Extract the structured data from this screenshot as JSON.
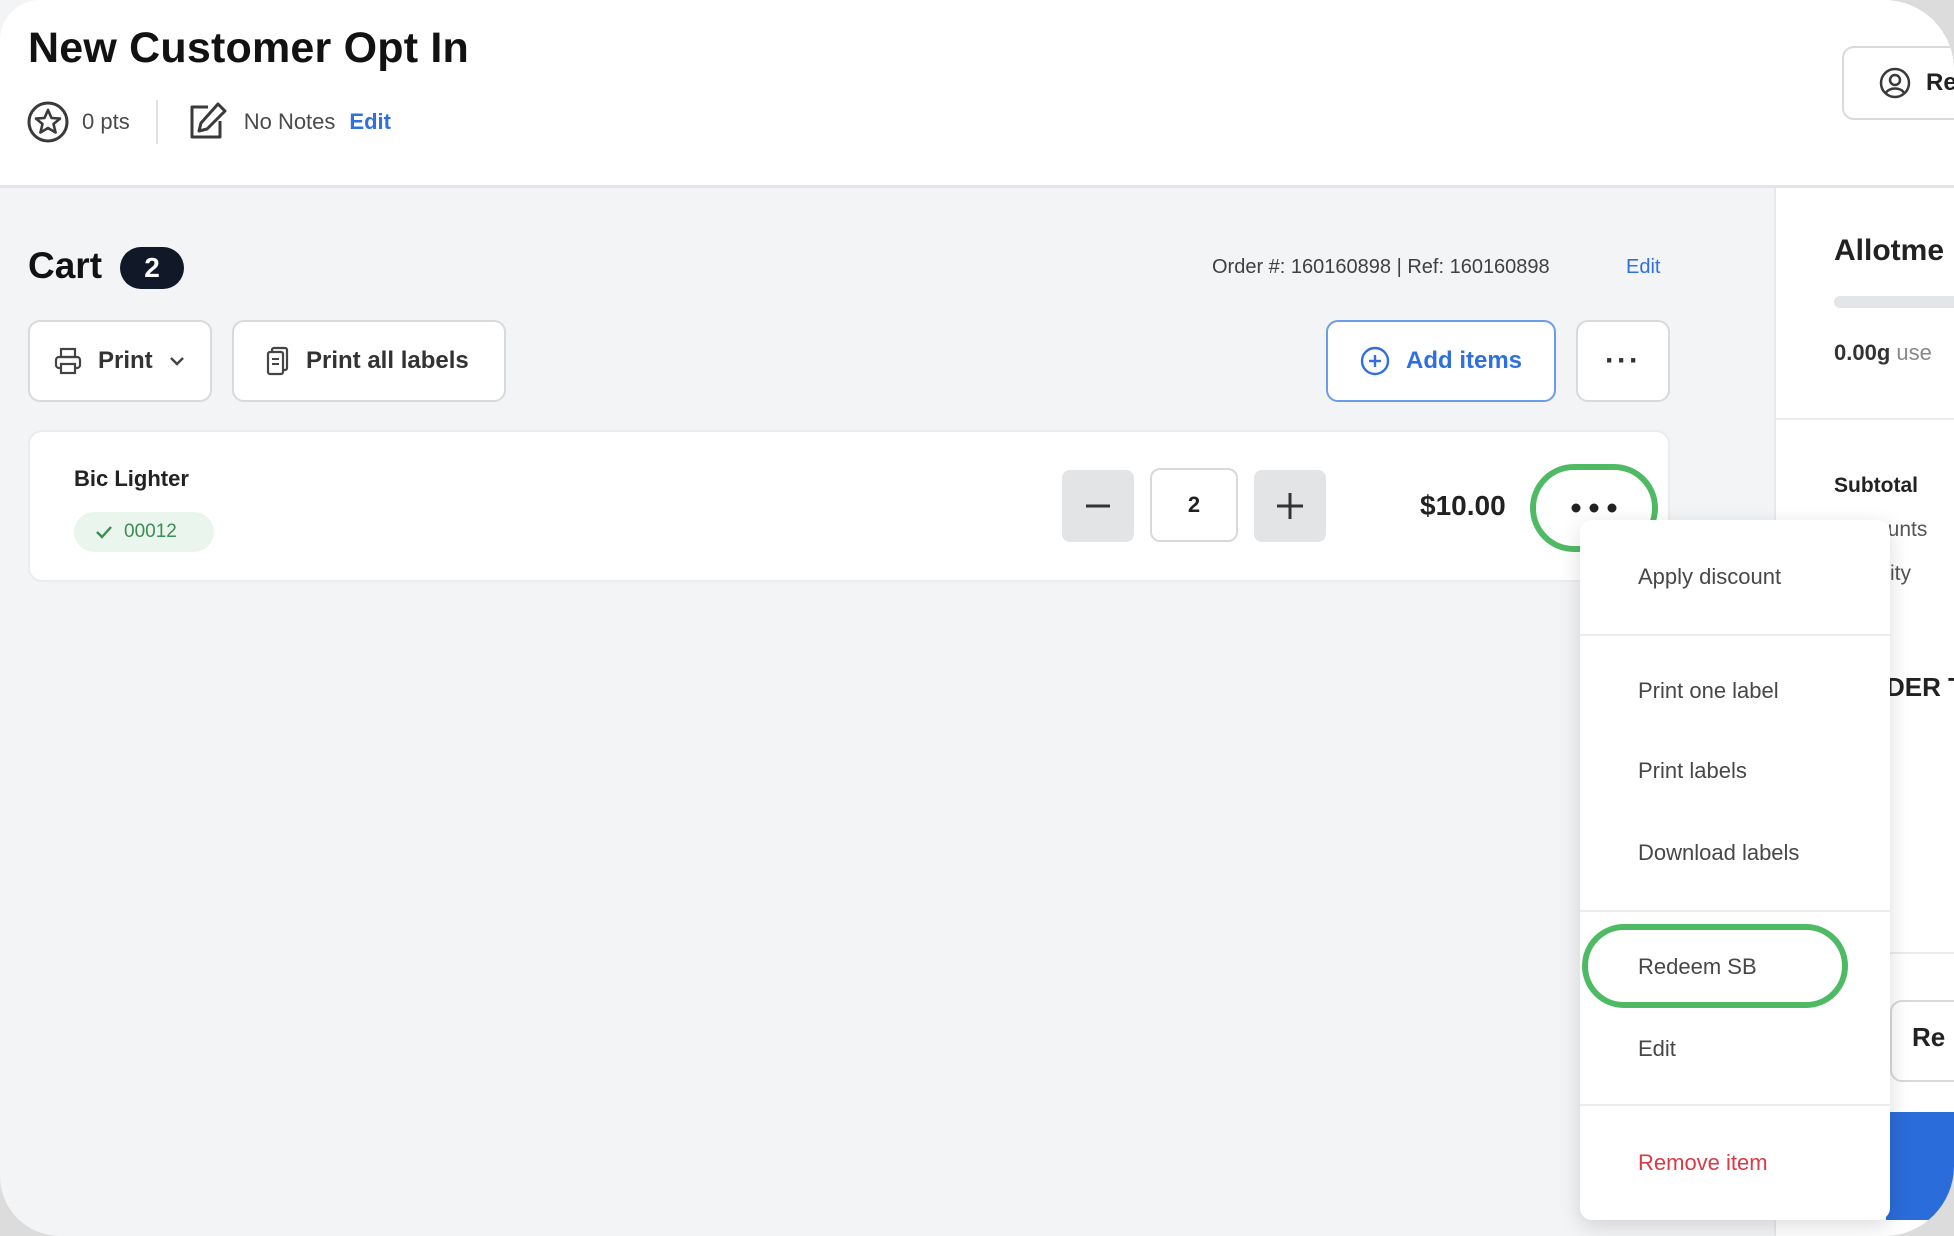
{
  "header": {
    "title": "New Customer Opt In",
    "points": "0 pts",
    "notes": "No Notes",
    "notes_edit": "Edit",
    "top_right_button": "Re"
  },
  "cart": {
    "title": "Cart",
    "count": "2",
    "order_ref": "Order #: 160160898 | Ref: 160160898",
    "order_edit": "Edit",
    "toolbar": {
      "print": "Print",
      "print_all_labels": "Print all labels",
      "add_items": "Add items",
      "more": "···"
    },
    "items": [
      {
        "name": "Bic Lighter",
        "badge": "00012",
        "quantity": "2",
        "price": "$10.00"
      }
    ]
  },
  "right_panel": {
    "title": "Allotme",
    "used_value": "0.00g",
    "used_label": "use",
    "subtotal": "Subtotal",
    "discounts": "ounts",
    "quantity": "ity",
    "order_total": "DER T",
    "action_button": "Re"
  },
  "item_menu": {
    "apply_discount": "Apply discount",
    "print_one_label": "Print one label",
    "print_labels": "Print labels",
    "download_labels": "Download labels",
    "redeem_sb": "Redeem SB",
    "edit": "Edit",
    "remove_item": "Remove item"
  },
  "colors": {
    "accent_blue": "#2f6fe0",
    "highlight_green": "#4fba64",
    "danger_red": "#d93a45",
    "badge_dark": "#111827"
  }
}
